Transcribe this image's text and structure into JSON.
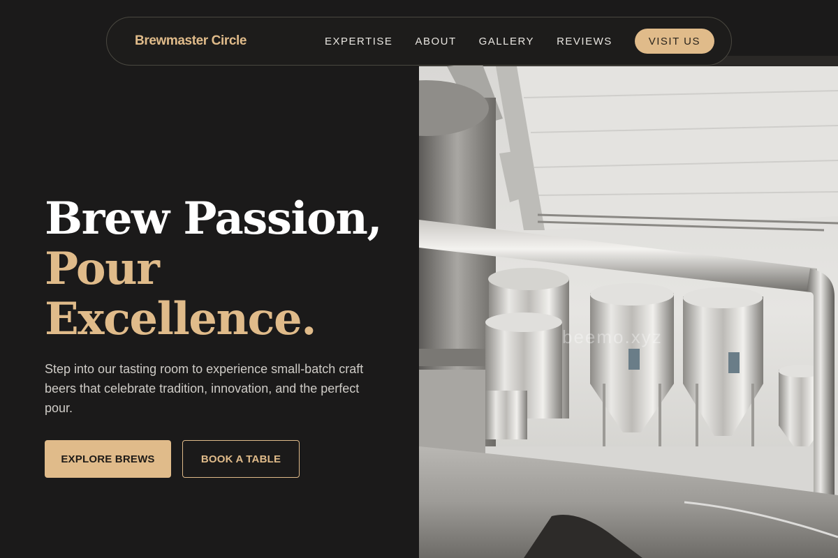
{
  "nav": {
    "brand": "Brewmaster Circle",
    "links": [
      "EXPERTISE",
      "ABOUT",
      "GALLERY",
      "REVIEWS"
    ],
    "cta": "VISIT US"
  },
  "hero": {
    "title_line1": "Brew Passion,",
    "title_line2": "Pour",
    "title_line3": "Excellence.",
    "description": "Step into our tasting room to experience small-batch craft beers that celebrate tradition, innovation, and the perfect pour.",
    "primary_button": "EXPLORE BREWS",
    "secondary_button": "BOOK A TABLE",
    "image_watermark": "beemo.xyz"
  },
  "colors": {
    "background": "#1b1a1a",
    "accent": "#e0bb8a",
    "text_primary": "#ffffff",
    "text_secondary": "#cfccc7"
  }
}
